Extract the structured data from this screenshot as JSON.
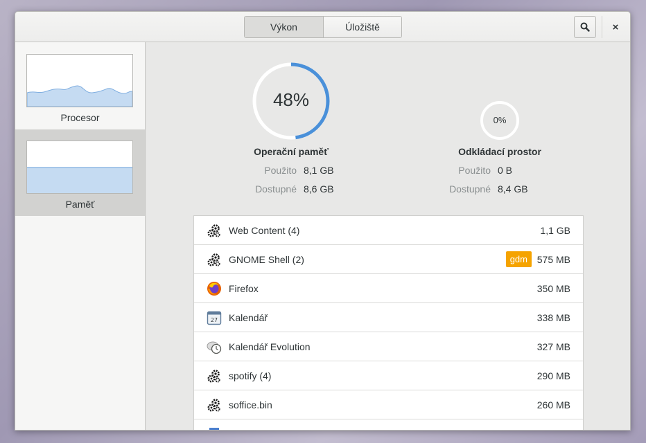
{
  "header": {
    "tabs": [
      {
        "label": "Výkon",
        "active": true
      },
      {
        "label": "Úložiště",
        "active": false
      }
    ],
    "search_icon": "search-icon",
    "close_icon": "close-icon",
    "close_glyph": "×"
  },
  "sidebar": {
    "items": [
      {
        "label": "Procesor",
        "selected": false
      },
      {
        "label": "Paměť",
        "selected": true
      }
    ]
  },
  "memory": {
    "percent": 48,
    "percent_label": "48%",
    "title": "Operační paměť",
    "used_label": "Použito",
    "used_value": "8,1 GB",
    "available_label": "Dostupné",
    "available_value": "8,6 GB"
  },
  "swap": {
    "percent": 0,
    "percent_label": "0%",
    "title": "Odkládací prostor",
    "used_label": "Použito",
    "used_value": "0 B",
    "available_label": "Dostupné",
    "available_value": "8,4 GB"
  },
  "processes": [
    {
      "name": "Web Content (4)",
      "value": "1,1 GB",
      "icon": "gears-icon",
      "badge": ""
    },
    {
      "name": "GNOME Shell (2)",
      "value": "575 MB",
      "icon": "gears-icon",
      "badge": "gdm"
    },
    {
      "name": "Firefox",
      "value": "350 MB",
      "icon": "firefox-icon",
      "badge": ""
    },
    {
      "name": "Kalendář",
      "value": "338 MB",
      "icon": "calendar-icon",
      "badge": ""
    },
    {
      "name": "Kalendář Evolution",
      "value": "327 MB",
      "icon": "evolution-clock-icon",
      "badge": ""
    },
    {
      "name": "spotify (4)",
      "value": "290 MB",
      "icon": "gears-icon",
      "badge": ""
    },
    {
      "name": "soffice.bin",
      "value": "260 MB",
      "icon": "gears-icon",
      "badge": ""
    }
  ],
  "colors": {
    "accent": "#4a90d9",
    "badge": "#f5a300",
    "graph_fill": "#c5dbf2",
    "graph_line": "#7faee0"
  },
  "calendar_icon_text": "27"
}
